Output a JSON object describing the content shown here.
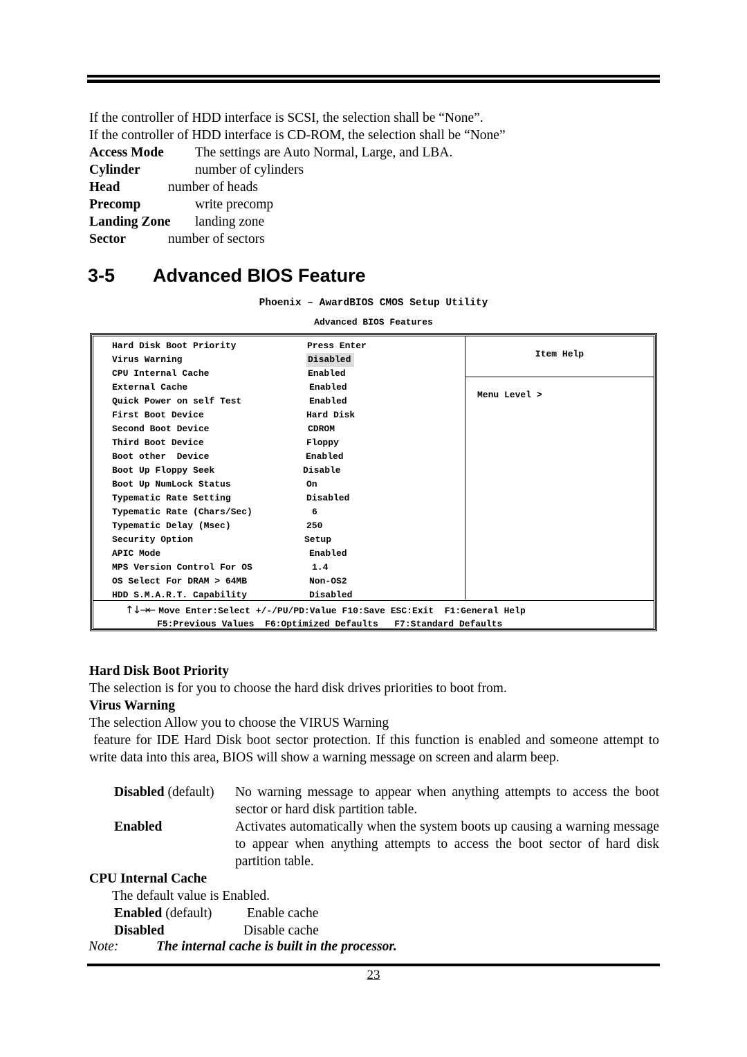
{
  "intro": {
    "line1": "If the controller of HDD interface is SCSI, the selection shall be “None”.",
    "line2": "If the controller of HDD interface is CD-ROM, the selection shall be “None”",
    "definitions": [
      {
        "term": "Access Mode",
        "desc": "The settings are Auto Normal, Large, and LBA."
      },
      {
        "term": "Cylinder",
        "desc": "number of cylinders"
      },
      {
        "term": "Head",
        "desc": "number of heads"
      },
      {
        "term": "Precomp",
        "desc": "write precomp"
      },
      {
        "term": "Landing Zone",
        "desc": "landing zone"
      },
      {
        "term": "Sector",
        "desc": "number of sectors"
      }
    ]
  },
  "section": {
    "number": "3-5",
    "title": "Advanced BIOS Feature"
  },
  "bios": {
    "title": "Phoenix – AwardBIOS CMOS Setup Utility",
    "subtitle": "Advanced BIOS Features",
    "rows": [
      {
        "label": "Hard Disk Boot Priority",
        "value": "Press Enter"
      },
      {
        "label": "Virus Warning",
        "value": "Disabled",
        "selected": true
      },
      {
        "label": "CPU Internal Cache",
        "value": "Enabled"
      },
      {
        "label": "External Cache",
        "value": "Enabled"
      },
      {
        "label": "Quick Power on self Test",
        "value": "Enabled"
      },
      {
        "label": "First Boot Device",
        "value": "Hard Disk"
      },
      {
        "label": "Second Boot Device",
        "value": "CDROM"
      },
      {
        "label": "Third Boot Device",
        "value": "Floppy"
      },
      {
        "label": "Boot other  Device",
        "value": "Enabled"
      },
      {
        "label": "Boot Up Floppy Seek",
        "value": "Disable"
      },
      {
        "label": "Boot Up NumLock Status",
        "value": "On"
      },
      {
        "label": "Typematic Rate Setting",
        "value": "Disabled"
      },
      {
        "label": "Typematic Rate (Chars/Sec)",
        "value": "6"
      },
      {
        "label": "Typematic Delay (Msec)",
        "value": "250"
      },
      {
        "label": "Security Option",
        "value": "Setup"
      },
      {
        "label": "APIC Mode",
        "value": "Enabled"
      },
      {
        "label": "MPS Version Control For OS",
        "value": "1.4"
      },
      {
        "label": "OS Select For DRAM > 64MB",
        "value": "Non-OS2"
      },
      {
        "label": "HDD S.M.A.R.T. Capability",
        "value": "Disabled"
      }
    ],
    "help_title": "Item Help",
    "help_text": "Menu Level >",
    "footer_arrows": "↑↓→←",
    "footer_line1": "Move Enter:Select +/-/PU/PD:Value F10:Save ESC:Exit  F1:General Help",
    "footer_line2": "F5:Previous Values  F6:Optimized Defaults   F7:Standard Defaults"
  },
  "hdbp": {
    "heading": "Hard Disk Boot Priority",
    "text": "The selection is for you to choose the hard disk drives priorities to boot from."
  },
  "virus": {
    "heading": "Virus Warning",
    "line1": "The selection Allow you to choose the VIRUS Warning",
    "para": "feature for IDE Hard Disk boot sector protection.   If this function is enabled and someone attempt to write data into this area, BIOS will show a warning message on screen and alarm beep.",
    "options": [
      {
        "term": "Disabled",
        "suffix": " (default)",
        "desc": "No warning message to appear when anything attempts to access the boot sector or hard disk partition table."
      },
      {
        "term": "Enabled",
        "suffix": "",
        "desc": "Activates automatically when the system boots up causing a warning message to appear when anything attempts to access the boot sector of hard disk partition table."
      }
    ]
  },
  "cpu_cache": {
    "heading": "CPU Internal Cache",
    "default_text": "The default value is Enabled.",
    "options": [
      {
        "term": "Enabled",
        "suffix": " (default)",
        "desc": "Enable cache"
      },
      {
        "term": "Disabled",
        "suffix": "",
        "desc": "Disable cache"
      }
    ]
  },
  "note": {
    "label": "Note:",
    "text": "The internal cache is built in the processor."
  },
  "page_number": "23"
}
